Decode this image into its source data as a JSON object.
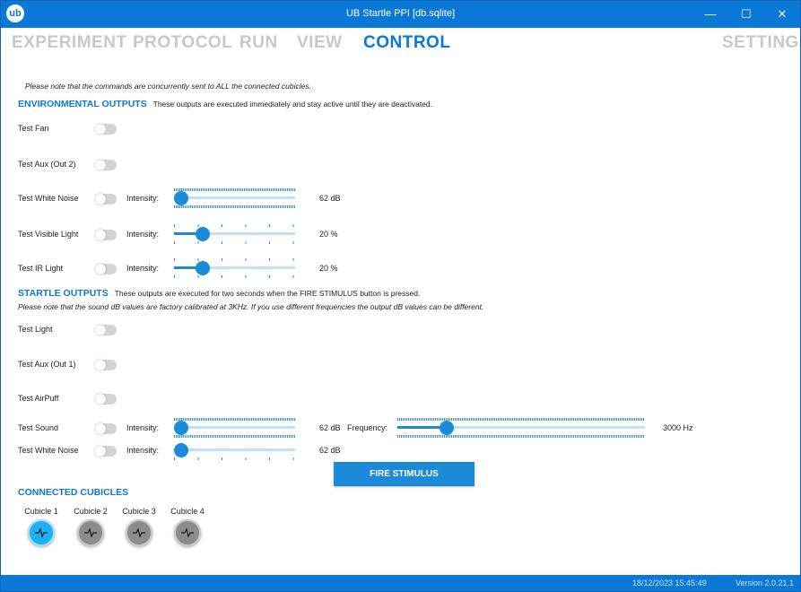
{
  "window": {
    "title": "UB Startle PPI [db.sqlite]",
    "logo": "ub-logo-icon",
    "minimize": "—",
    "maximize": "☐",
    "close": "✕"
  },
  "nav": {
    "experiment": "EXPERIMENT",
    "protocol": "PROTOCOL",
    "run": "RUN",
    "view": "VIEW",
    "control": "CONTROL",
    "settings": "SETTINGS",
    "active": "CONTROL"
  },
  "note": "Please note that the commands are concurrently sent to ALL the connected cubicles.",
  "environmental": {
    "title": "ENVIRONMENTAL OUTPUTS",
    "desc": "These outputs are executed immediately and stay active until they are deactivated.",
    "fan": {
      "label": "Test Fan",
      "on": false
    },
    "aux2": {
      "label": "Test Aux (Out 2)",
      "on": false
    },
    "white_noise": {
      "label": "Test White Noise",
      "on": false,
      "intensity_label": "Intensity:",
      "value": "62 dB",
      "level": 0.0
    },
    "visible_light": {
      "label": "Test Visible Light",
      "on": false,
      "intensity_label": "Intensity:",
      "value": "20 %",
      "level": 0.2
    },
    "ir_light": {
      "label": "Test IR Light",
      "on": false,
      "intensity_label": "Intensity:",
      "value": "20 %",
      "level": 0.2
    }
  },
  "startle": {
    "title": "STARTLE OUTPUTS",
    "desc": "These outputs are executed for two seconds when the FIRE STIMULUS button is pressed.",
    "note": "Please note that the sound dB values are factory calibrated at 3KHz. If you use different frequencies the output dB values can be different.",
    "light": {
      "label": "Test Light",
      "on": false
    },
    "aux1": {
      "label": "Test Aux (Out 1)",
      "on": false
    },
    "airpuff": {
      "label": "Test AirPuff",
      "on": false
    },
    "sound": {
      "label": "Test Sound",
      "on": false,
      "intensity_label": "Intensity:",
      "value": "62 dB",
      "level": 0.0,
      "frequency_label": "Frequency:",
      "frequency_value": "3000 Hz",
      "frequency_level": 0.18
    },
    "white_noise": {
      "label": "Test White Noise",
      "on": false,
      "intensity_label": "Intensity:",
      "value": "62 dB",
      "level": 0.0
    },
    "fire_button": "FIRE STIMULUS"
  },
  "cubicles": {
    "title": "CONNECTED CUBICLES",
    "items": [
      {
        "label": "Cubicle 1",
        "active": true
      },
      {
        "label": "Cubicle 2",
        "active": false
      },
      {
        "label": "Cubicle 3",
        "active": false
      },
      {
        "label": "Cubicle 4",
        "active": false
      }
    ]
  },
  "status": {
    "datetime": "18/12/2023 15:45:49",
    "version": "Version 2.0.21.1"
  },
  "colors": {
    "accent": "#0a78d7",
    "slider": "#1a8ad9",
    "active_cubicle": "#1fb0f4",
    "inactive_cubicle": "#8c8c8c"
  }
}
